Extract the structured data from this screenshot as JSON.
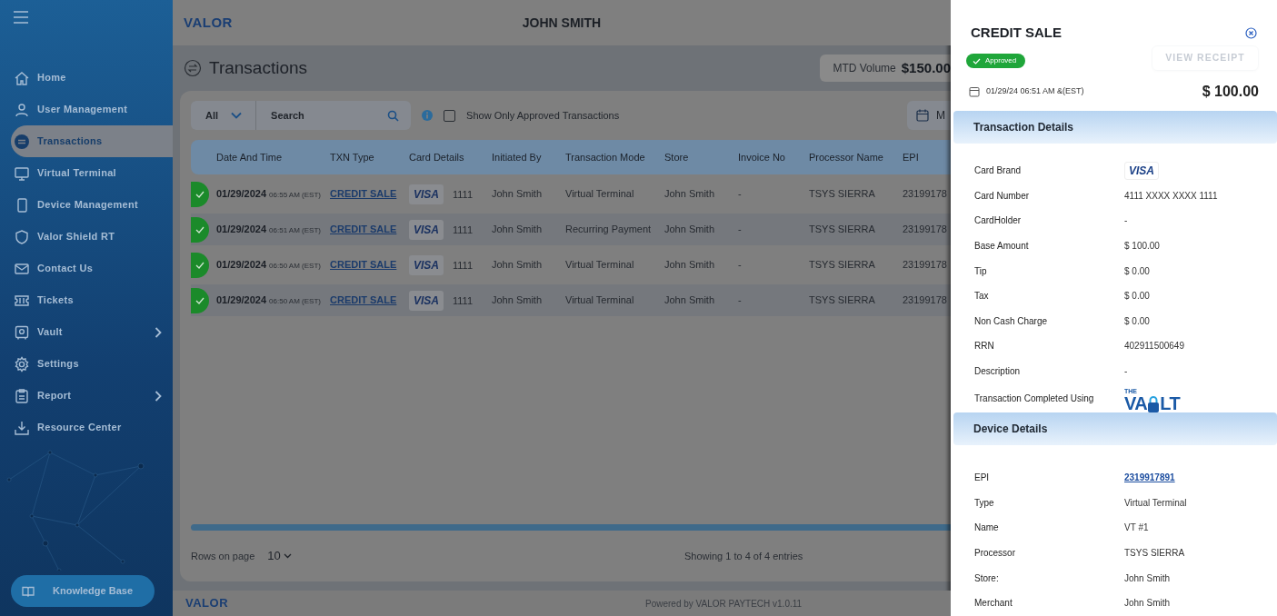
{
  "sidebar": {
    "items": [
      {
        "label": "Home",
        "selected": false,
        "submenu": false
      },
      {
        "label": "User Management",
        "selected": false,
        "submenu": false
      },
      {
        "label": "Transactions",
        "selected": true,
        "submenu": false
      },
      {
        "label": "Virtual Terminal",
        "selected": false,
        "submenu": false
      },
      {
        "label": "Device Management",
        "selected": false,
        "submenu": false
      },
      {
        "label": "Valor Shield RT",
        "selected": false,
        "submenu": false
      },
      {
        "label": "Contact Us",
        "selected": false,
        "submenu": false
      },
      {
        "label": "Tickets",
        "selected": false,
        "submenu": false
      },
      {
        "label": "Vault",
        "selected": false,
        "submenu": true
      },
      {
        "label": "Settings",
        "selected": false,
        "submenu": false
      },
      {
        "label": "Report",
        "selected": false,
        "submenu": true
      },
      {
        "label": "Resource Center",
        "selected": false,
        "submenu": false
      }
    ],
    "knowledge_base": "Knowledge Base"
  },
  "header": {
    "logo": "VALOR",
    "user": "JOHN SMITH"
  },
  "page": {
    "title": "Transactions",
    "mtd_label": "MTD Volume",
    "mtd_value": "$150.00"
  },
  "filters": {
    "type": "All",
    "search_placeholder": "Search",
    "approved_only_label": "Show Only Approved Transactions",
    "approved_only_checked": false,
    "date_button": "M"
  },
  "table": {
    "columns": [
      "Date And Time",
      "TXN Type",
      "Card Details",
      "Initiated By",
      "Transaction Mode",
      "Store",
      "Invoice No",
      "Processor Name",
      "EPI"
    ],
    "rows": [
      {
        "approved": true,
        "date": "01/29/2024",
        "time": "06:55 AM (EST)",
        "txn_type": "CREDIT SALE",
        "card_brand": "VISA",
        "last4": "1111",
        "initiated_by": "John Smith",
        "mode": "Virtual Terminal",
        "store": "John Smith",
        "invoice": "-",
        "processor": "TSYS SIERRA",
        "epi": "23199178"
      },
      {
        "approved": true,
        "date": "01/29/2024",
        "time": "06:51 AM (EST)",
        "txn_type": "CREDIT SALE",
        "card_brand": "VISA",
        "last4": "1111",
        "initiated_by": "John Smith",
        "mode": "Recurring Payment",
        "store": "John Smith",
        "invoice": "-",
        "processor": "TSYS SIERRA",
        "epi": "23199178"
      },
      {
        "approved": true,
        "date": "01/29/2024",
        "time": "06:50 AM (EST)",
        "txn_type": "CREDIT SALE",
        "card_brand": "VISA",
        "last4": "1111",
        "initiated_by": "John Smith",
        "mode": "Virtual Terminal",
        "store": "John Smith",
        "invoice": "-",
        "processor": "TSYS SIERRA",
        "epi": "23199178"
      },
      {
        "approved": true,
        "date": "01/29/2024",
        "time": "06:50 AM (EST)",
        "txn_type": "CREDIT SALE",
        "card_brand": "VISA",
        "last4": "1111",
        "initiated_by": "John Smith",
        "mode": "Virtual Terminal",
        "store": "John Smith",
        "invoice": "-",
        "processor": "TSYS SIERRA",
        "epi": "23199178"
      }
    ],
    "rows_label": "Rows on page",
    "rows_value": "10",
    "showing": "Showing 1 to 4 of 4 entries"
  },
  "footer": {
    "logo": "VALOR",
    "powered_by": "Powered by VALOR PAYTECH",
    "version": "v1.0.11"
  },
  "drawer": {
    "title": "CREDIT SALE",
    "status": "Approved",
    "receipt_button": "VIEW RECEIPT",
    "date": "01/29/24 06:51 AM &(EST)",
    "amount": "$ 100.00",
    "sections": [
      {
        "title": "Transaction Details",
        "fields": [
          {
            "kind": "brand",
            "label": "Card Brand",
            "value": "VISA"
          },
          {
            "kind": "text",
            "label": "Card Number",
            "value": "4111 XXXX XXXX 1111"
          },
          {
            "kind": "text",
            "label": "CardHolder",
            "value": "-"
          },
          {
            "kind": "text",
            "label": "Base Amount",
            "value": "$ 100.00"
          },
          {
            "kind": "text",
            "label": "Tip",
            "value": "$ 0.00"
          },
          {
            "kind": "text",
            "label": "Tax",
            "value": "$ 0.00"
          },
          {
            "kind": "text",
            "label": "Non Cash Charge",
            "value": "$ 0.00"
          },
          {
            "kind": "text",
            "label": "RRN",
            "value": "402911500649"
          },
          {
            "kind": "text",
            "label": "Description",
            "value": "-"
          },
          {
            "kind": "logo",
            "label": "Transaction Completed Using",
            "small": "THE",
            "left": "VA",
            "right": "LT"
          }
        ]
      },
      {
        "title": "Device Details",
        "fields": [
          {
            "kind": "link",
            "label": "EPI",
            "value": "2319917891"
          },
          {
            "kind": "text",
            "label": "Type",
            "value": "Virtual Terminal"
          },
          {
            "kind": "text",
            "label": "Name",
            "value": "VT #1"
          },
          {
            "kind": "text",
            "label": "Processor",
            "value": "TSYS SIERRA"
          },
          {
            "kind": "text",
            "label": "Store:",
            "value": "John Smith"
          },
          {
            "kind": "text",
            "label": "Merchant",
            "value": "John Smith"
          }
        ]
      }
    ]
  }
}
